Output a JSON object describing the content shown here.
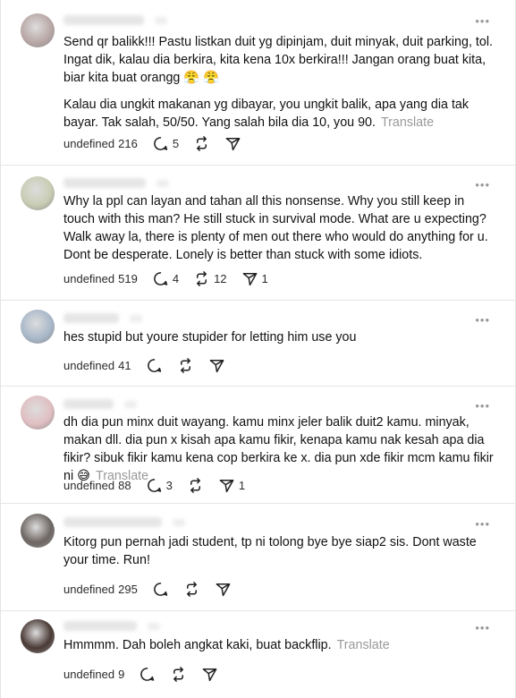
{
  "comments": [
    {
      "paragraphs": [
        "Send qr balikk!!! Pastu listkan duit yg dipinjam, duit minyak, duit parking, tol. Ingat dik, kalau dia berkira, kita kena 10x berkira!!! Jangan orang buat kita, biar kita buat orangg 😤 😤",
        "Kalau dia ungkit makanan yg dibayar, you ungkit balik, apa yang dia tak bayar. Tak salah, 50/50. Yang salah bila dia 10, you 90."
      ],
      "translate": "Translate",
      "likes": "216",
      "replies": "5",
      "reposts": "",
      "shares": ""
    },
    {
      "paragraphs": [
        "Why la ppl can layan and tahan all this nonsense. Why you still keep in touch with this man? He still stuck in survival mode. What are u expecting? Walk away la, there is plenty of men out there who would do anything for u. Dont be desperate. Lonely is better than stuck with some idiots."
      ],
      "translate": "",
      "likes": "519",
      "replies": "4",
      "reposts": "12",
      "shares": "1"
    },
    {
      "paragraphs": [
        "hes stupid but youre stupider for letting him use you"
      ],
      "translate": "",
      "likes": "41",
      "replies": "",
      "reposts": "",
      "shares": ""
    },
    {
      "paragraphs": [
        "dh dia pun minx duit wayang. kamu minx jeler balik duit2 kamu. minyak, makan dll. dia pun x kisah apa kamu fikir, kenapa kamu nak kesah apa dia fikir? sibuk fikir kamu kena cop berkira ke x. dia pun xde fikir mcm kamu fikir ni 😅"
      ],
      "translate": "Translate",
      "likes": "88",
      "replies": "3",
      "reposts": "",
      "shares": "1"
    },
    {
      "paragraphs": [
        "Kitorg pun pernah jadi student, tp ni tolong bye bye siap2 sis. Dont waste your time. Run!"
      ],
      "translate": "",
      "likes": "295",
      "replies": "",
      "reposts": "",
      "shares": ""
    },
    {
      "paragraphs": [
        "Hmmmm. Dah boleh angkat kaki, buat backflip."
      ],
      "translate": "Translate",
      "likes": "9",
      "replies": "",
      "reposts": "",
      "shares": ""
    }
  ],
  "icons": {
    "like": "heart-icon",
    "reply": "comment-icon",
    "repost": "repost-icon",
    "share": "send-icon",
    "more": "more-options-icon"
  },
  "colors": {
    "text": "#101010",
    "muted": "#999999",
    "divider": "#e6e6e6"
  }
}
